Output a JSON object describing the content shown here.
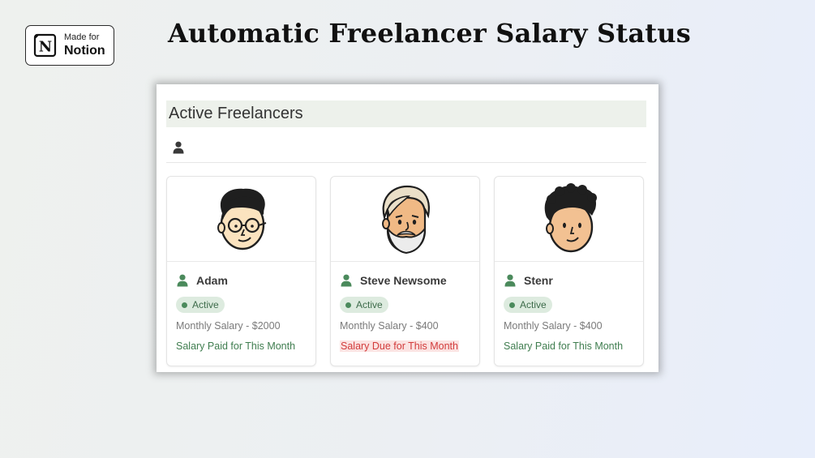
{
  "badge": {
    "small": "Made for",
    "big": "Notion",
    "logo_letter": "N"
  },
  "title": "Automatic Freelancer Salary Status",
  "panel": {
    "title": "Active Freelancers",
    "person_icon": "person-icon"
  },
  "colors": {
    "accent_green": "#4b8a5c",
    "due_red": "#d23b3b",
    "pill_bg": "#ddebdf"
  },
  "freelancers": [
    {
      "name": "Adam",
      "avatar": "avatar-glasses-icon",
      "status": "Active",
      "salary": "Monthly Salary - $2000",
      "salary_status": "Salary Paid for This Month",
      "salary_state": "paid"
    },
    {
      "name": "Steve Newsome",
      "avatar": "avatar-beard-icon",
      "status": "Active",
      "salary": "Monthly Salary - $400",
      "salary_status": "Salary Due for This Month",
      "salary_state": "due"
    },
    {
      "name": "Stenr",
      "avatar": "avatar-curly-icon",
      "status": "Active",
      "salary": "Monthly Salary - $400",
      "salary_status": "Salary Paid for This Month",
      "salary_state": "paid"
    }
  ]
}
